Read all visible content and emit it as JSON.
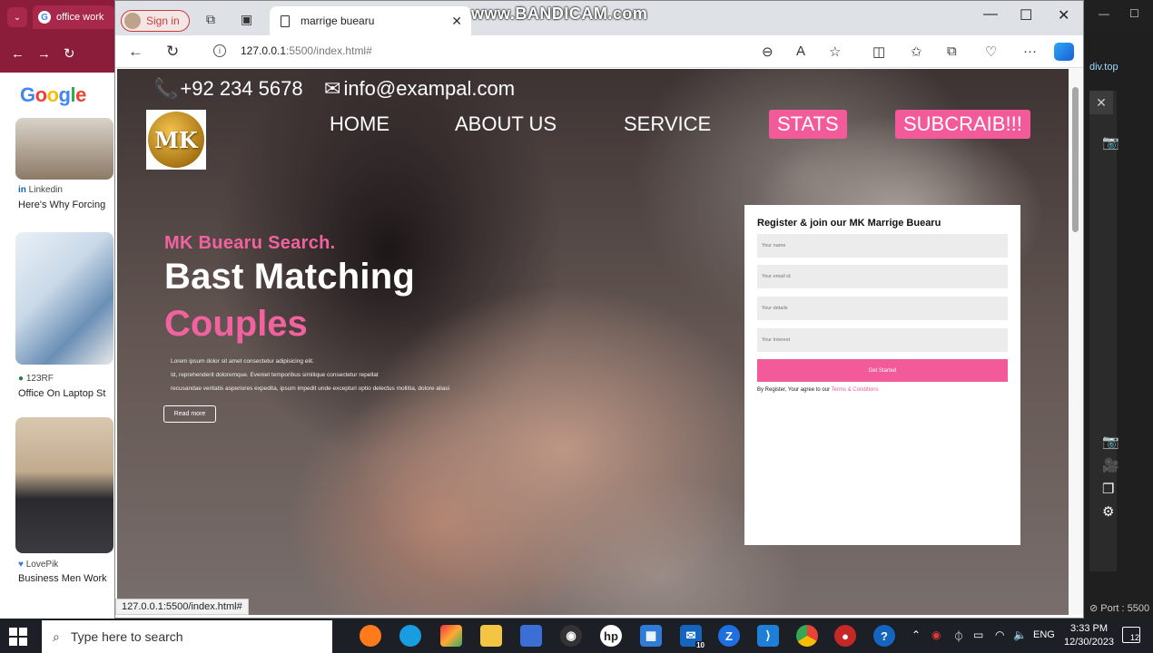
{
  "background_browser": {
    "tab_title": "office work",
    "google_logo": [
      "G",
      "o",
      "o",
      "g",
      "l",
      "e"
    ],
    "results": [
      {
        "source": "Linkedin",
        "caption": "Here's Why Forcing"
      },
      {
        "source": "123RF",
        "caption": "Office On Laptop St"
      },
      {
        "source": "LovePik",
        "caption": "Business Men Work"
      }
    ]
  },
  "browser": {
    "profile_label": "Sign in",
    "tab_title": "marrige buearu",
    "url_host": "127.0.0.1",
    "url_rest": ":5500/index.html#",
    "status_url": "127.0.0.1:5500/index.html#",
    "watermark": "www.BANDICAM.com"
  },
  "site": {
    "phone": "+92 234 5678",
    "email": "info@exampal.com",
    "logo_text": "MK",
    "nav": [
      "HOME",
      "ABOUT US",
      "SERVICE",
      "STATS",
      "SUBCRAIB!!!"
    ],
    "eyebrow": "MK Buearu Search.",
    "heading_line1": "Bast Matching",
    "heading_line2": "Couples",
    "body_lines": [
      "Lorem ipsum dolor sit amet consectetur adipisicing elit.",
      "Id, reprehenderit doloremque. Eveniet temporibus similique consectetur repellat",
      "recusandae veritatis asperiores expedita, ipsum impedit unde excepturi optio delectus mollitia, dolore aliasi"
    ],
    "read_more": "Read more",
    "form": {
      "title": "Register & join our MK Marrige Buearu",
      "fields": [
        "Your name",
        "Your email id",
        "Your details",
        "Your Interest"
      ],
      "submit": "Get Started",
      "terms_prefix": "By Register, Your agree to our",
      "terms_link": "Terms & Conditions"
    }
  },
  "ide": {
    "port": "Port : 5500",
    "breadcrumb": "div.top"
  },
  "taskbar": {
    "search_placeholder": "Type here to search",
    "lang": "ENG",
    "time": "3:33 PM",
    "date": "12/30/2023",
    "mail_badge": "10",
    "notification_badge": "12"
  },
  "colors": {
    "accent_pink": "#f25a9a",
    "bg_browser_red": "#8b1c3a"
  }
}
